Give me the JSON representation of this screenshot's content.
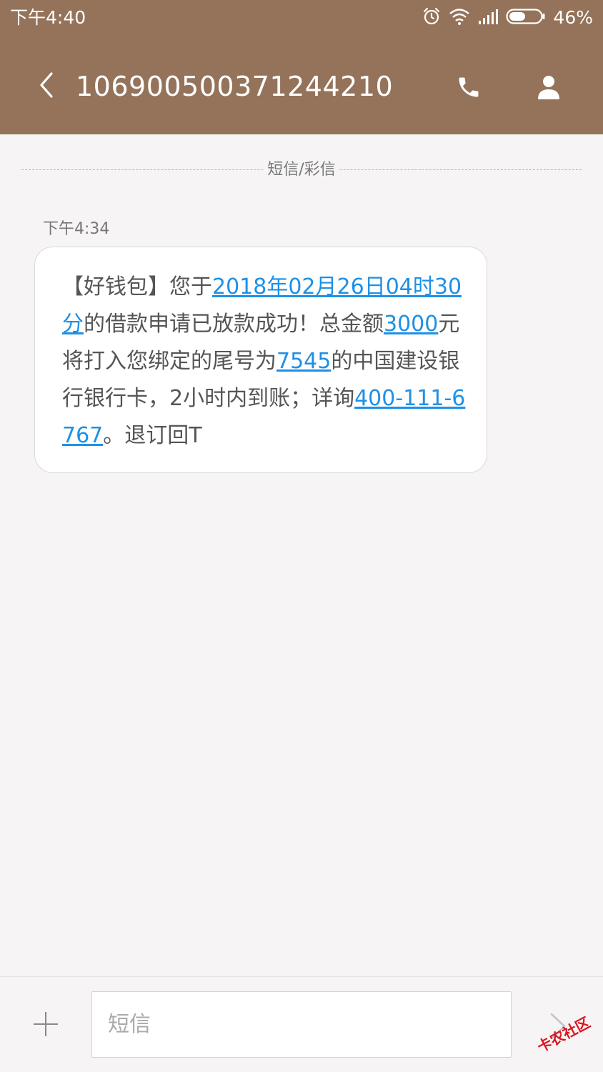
{
  "status_bar": {
    "time": "下午4:40",
    "battery_percent": "46%",
    "icons": [
      "alarm-icon",
      "wifi-icon",
      "signal-icon",
      "battery-icon"
    ]
  },
  "header": {
    "title": "106900500371244210",
    "icons": [
      "back-arrow-icon",
      "phone-icon",
      "contact-icon"
    ],
    "bg_color": "#94735a"
  },
  "thread": {
    "divider_label": "短信/彩信",
    "messages": [
      {
        "time": "下午4:34",
        "segments": [
          {
            "text": "【好钱包】您于",
            "link": false
          },
          {
            "text": "2018年02月26日04时30分",
            "link": true
          },
          {
            "text": "的借款申请已放款成功！总金额",
            "link": false
          },
          {
            "text": "3000",
            "link": true
          },
          {
            "text": "元将打入您绑定的尾号为",
            "link": false
          },
          {
            "text": "7545",
            "link": true
          },
          {
            "text": "的中国建设银行银行卡，2小时内到账；详询",
            "link": false
          },
          {
            "text": "400-111-6767",
            "link": true
          },
          {
            "text": "。退订回T",
            "link": false
          }
        ]
      }
    ],
    "link_color": "#1e90e6"
  },
  "composer": {
    "placeholder": "短信",
    "value": ""
  },
  "watermark": {
    "text": "卡农社区"
  }
}
